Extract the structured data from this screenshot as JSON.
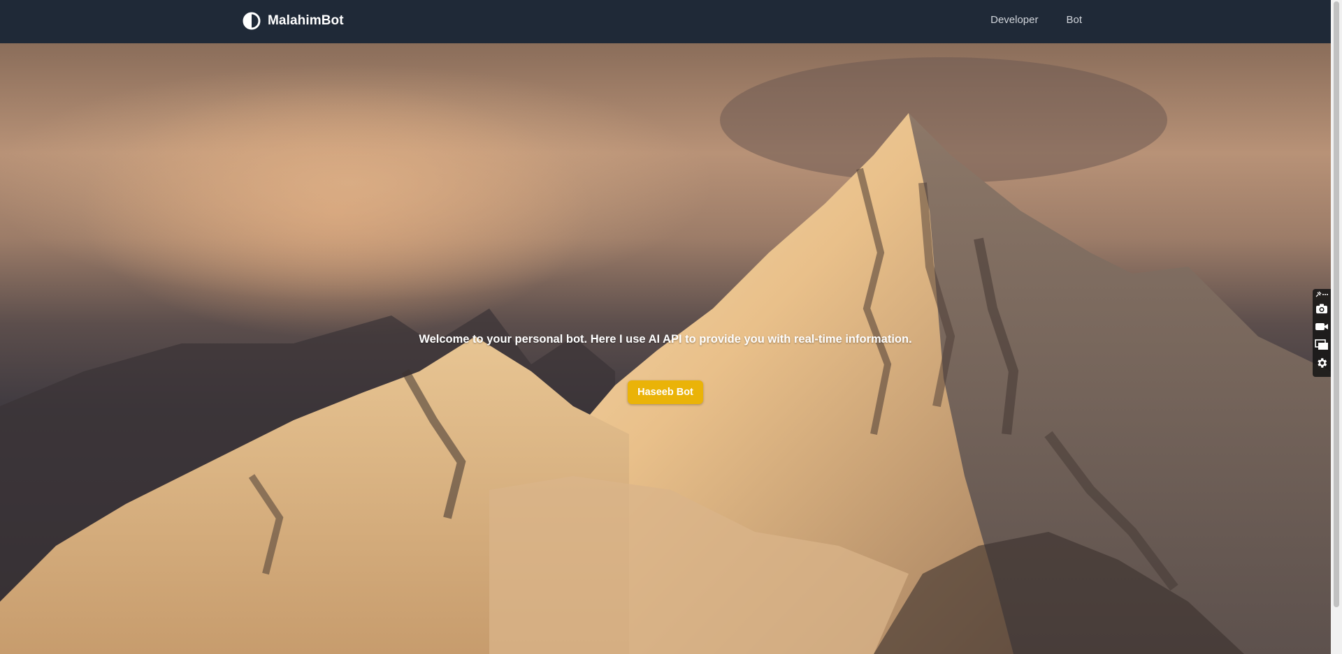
{
  "navbar": {
    "brand": "MalahimBot",
    "links": [
      {
        "label": "Developer"
      },
      {
        "label": "Bot"
      }
    ]
  },
  "hero": {
    "message": "Welcome to your personal bot. Here I use AI API to provide you with real-time information.",
    "button_label": "Haseeb Bot",
    "background": "snow-capped mountain peak at sunset"
  },
  "side_toolbar": {
    "icons": [
      "pin-icon",
      "more-icon",
      "camera-icon",
      "video-camera-icon",
      "windows-icon",
      "gear-icon"
    ]
  },
  "colors": {
    "navbar_bg": "#1f2937",
    "button_bg": "#eab308",
    "text": "#ffffff",
    "nav_link": "#d1d5db"
  }
}
